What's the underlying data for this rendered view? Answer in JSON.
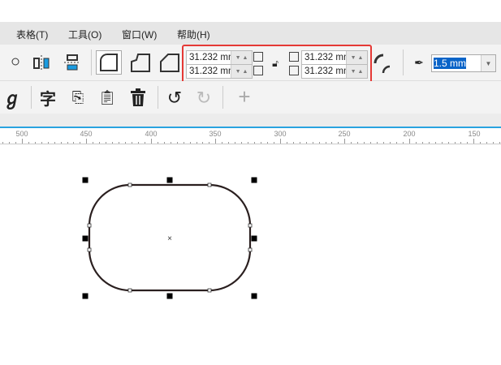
{
  "menu": [
    "表格(T)",
    "工具(O)",
    "窗口(W)",
    "帮助(H)"
  ],
  "corner": {
    "width_top": "31.232 mm",
    "width_bottom": "31.232 mm",
    "right_top": "31.232 mm",
    "right_bottom": "31.232 mm"
  },
  "outline_width": "1.5 mm",
  "ruler": [
    "500",
    "450",
    "400",
    "350",
    "300",
    "250",
    "200",
    "150"
  ],
  "colors": {
    "accent": "#29a3e0",
    "highlight": "#e53935",
    "selection": "#0a64c8"
  }
}
